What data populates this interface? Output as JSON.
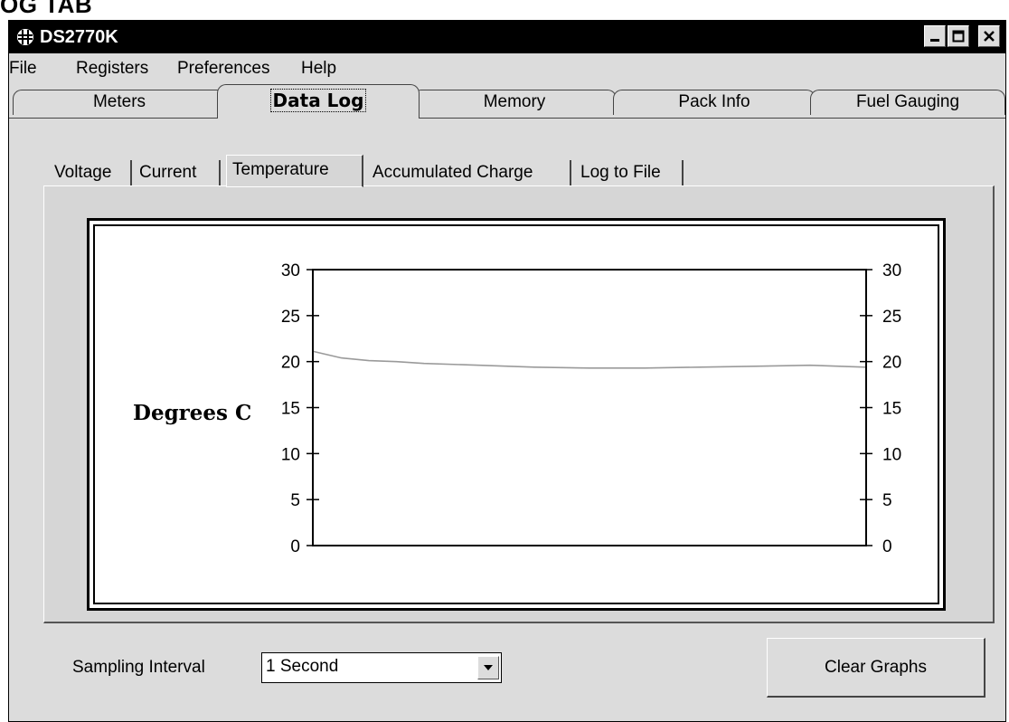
{
  "page_caption": "OG TAB",
  "window": {
    "title": "DS2770K"
  },
  "menu": [
    "File",
    "Registers",
    "Preferences",
    "Help"
  ],
  "main_tabs": [
    "Meters",
    "Data Log",
    "Memory",
    "Pack Info",
    "Fuel Gauging"
  ],
  "main_tab_active": "Data Log",
  "sub_tabs": [
    "Voltage",
    "Current",
    "Temperature",
    "Accumulated Charge",
    "Log to File"
  ],
  "sub_tab_active": "Temperature",
  "chart_data": {
    "type": "line",
    "title": "",
    "ylabel": "Degrees C",
    "xlabel": "",
    "ylim": [
      0,
      30
    ],
    "yticks": [
      0,
      5,
      10,
      15,
      20,
      25,
      30
    ],
    "yticks_right": [
      0,
      5,
      10,
      15,
      20,
      25,
      30
    ],
    "grid": false,
    "series": [
      {
        "color": "#9a9a9a",
        "x": [
          0,
          5,
          10,
          15,
          20,
          30,
          40,
          50,
          60,
          70,
          80,
          90,
          100
        ],
        "y": [
          21.1,
          20.4,
          20.1,
          20.0,
          19.8,
          19.6,
          19.4,
          19.3,
          19.3,
          19.4,
          19.5,
          19.6,
          19.4
        ]
      }
    ]
  },
  "controls": {
    "sampling_label": "Sampling Interval",
    "sampling_value": "1 Second",
    "clear_button": "Clear Graphs"
  },
  "icons": {
    "app": "app-icon",
    "minimize": "minimize-icon",
    "maximize": "maximize-icon",
    "close": "close-icon",
    "dropdown": "chevron-down-icon"
  }
}
